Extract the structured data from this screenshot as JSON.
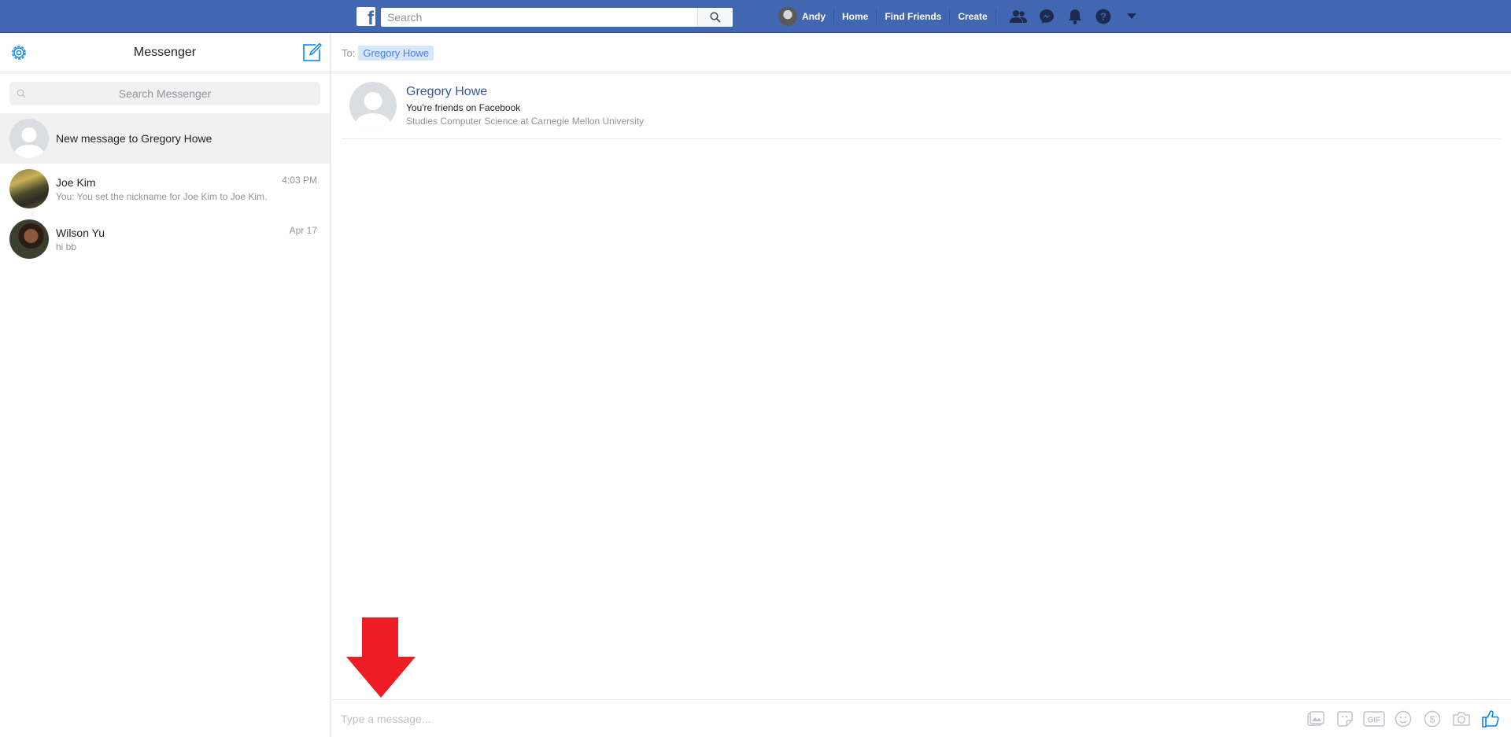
{
  "topbar": {
    "search_placeholder": "Search",
    "profile_name": "Andy",
    "links": [
      "Home",
      "Find Friends",
      "Create"
    ],
    "brand_color": "#4267b2"
  },
  "sidebar": {
    "title": "Messenger",
    "search_placeholder": "Search Messenger",
    "conversations": [
      {
        "name": "New message to Gregory Howe",
        "snippet": "",
        "time": ""
      },
      {
        "name": "Joe Kim",
        "snippet": "You: You set the nickname for Joe Kim to Joe Kim.",
        "time": "4:03 PM"
      },
      {
        "name": "Wilson Yu",
        "snippet": "hi bb",
        "time": "Apr 17"
      }
    ]
  },
  "thread": {
    "to_label": "To:",
    "recipient": "Gregory Howe",
    "profile": {
      "name": "Gregory Howe",
      "line1": "You're friends on Facebook",
      "line2": "Studies Computer Science at Carnegie Mellon University"
    },
    "composer_placeholder": "Type a message...",
    "composer_icons": [
      "image-icon",
      "sticker-icon",
      "gif-icon",
      "emoji-icon",
      "payment-icon",
      "camera-icon",
      "thumbs-up-icon"
    ]
  },
  "colors": {
    "accent": "#0084ff",
    "annotation_arrow": "#ee1c25"
  }
}
